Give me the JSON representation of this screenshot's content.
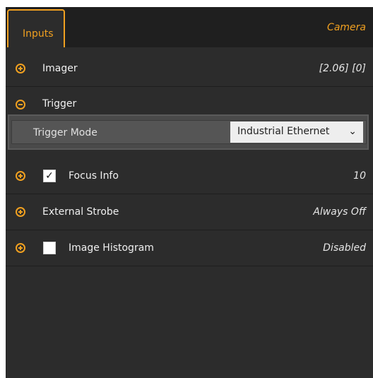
{
  "tabs": {
    "active_label": "Inputs",
    "right_label": "Camera"
  },
  "rows": [
    {
      "label": "Imager",
      "value": "[2.06]  [0]",
      "expanded": false
    },
    {
      "label": "Trigger",
      "value": "",
      "expanded": true
    },
    {
      "label": "Focus Info",
      "value": "10",
      "checked": true
    },
    {
      "label": "External Strobe",
      "value": "Always Off"
    },
    {
      "label": "Image Histogram",
      "value": "Disabled",
      "checked": false
    }
  ],
  "trigger_mode": {
    "label": "Trigger Mode",
    "selected": "Industrial Ethernet"
  },
  "colors": {
    "accent": "#f0a020",
    "panel": "#2c2c2c",
    "tabbar": "#1f1f1f"
  }
}
